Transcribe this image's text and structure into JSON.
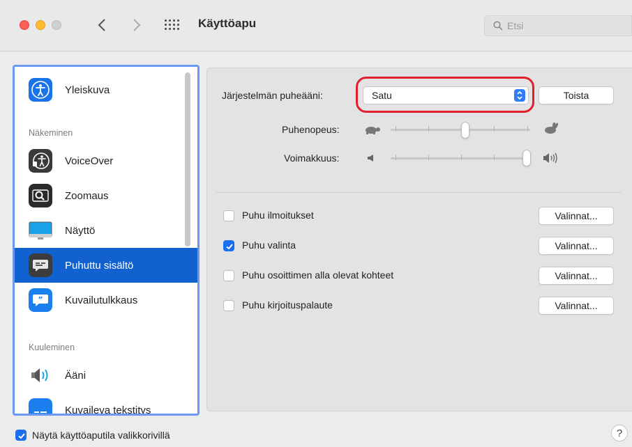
{
  "window": {
    "title": "Käyttöapu",
    "search_placeholder": "Etsi"
  },
  "sidebar": {
    "items": [
      {
        "label": "Yleiskuva",
        "icon": "accessibility-icon",
        "color": "#1a73e8"
      },
      {
        "label": "VoiceOver",
        "icon": "voiceover-icon",
        "color": "#333333"
      },
      {
        "label": "Zoomaus",
        "icon": "zoom-icon",
        "color": "#2a2a2a"
      },
      {
        "label": "Näyttö",
        "icon": "display-icon",
        "color": "#1aa3e8"
      },
      {
        "label": "Puhuttu sisältö",
        "icon": "spoken-content-icon",
        "color": "#3c3c3c",
        "selected": true
      },
      {
        "label": "Kuvailutulkkaus",
        "icon": "audio-description-icon",
        "color": "#1c7ff0"
      },
      {
        "label": "Ääni",
        "icon": "speaker-icon",
        "color": "#555555"
      },
      {
        "label": "Kuvaileva tekstitys",
        "icon": "captions-icon",
        "color": "#1c7ff0"
      }
    ],
    "section_seeing": "Näkeminen",
    "section_hearing": "Kuuleminen"
  },
  "speech": {
    "voice_label": "Järjestelmän puheääni:",
    "voice_value": "Satu",
    "play_button": "Toista",
    "rate_label": "Puhenopeus:",
    "rate_value": 0.5,
    "volume_label": "Voimakkuus:",
    "volume_value": 1.0
  },
  "options": [
    {
      "label": "Puhu ilmoitukset",
      "checked": false,
      "button": "Valinnat..."
    },
    {
      "label": "Puhu valinta",
      "checked": true,
      "button": "Valinnat..."
    },
    {
      "label": "Puhu osoittimen alla olevat kohteet",
      "checked": false,
      "button": "Valinnat..."
    },
    {
      "label": "Puhu kirjoituspalaute",
      "checked": false,
      "button": "Valinnat..."
    }
  ],
  "footer": {
    "menubar_label": "Näytä käyttöaputila valikkorivillä",
    "menubar_checked": true,
    "help": "?"
  },
  "colors": {
    "accent": "#1161d1",
    "highlight_ring": "#e21f2c"
  }
}
